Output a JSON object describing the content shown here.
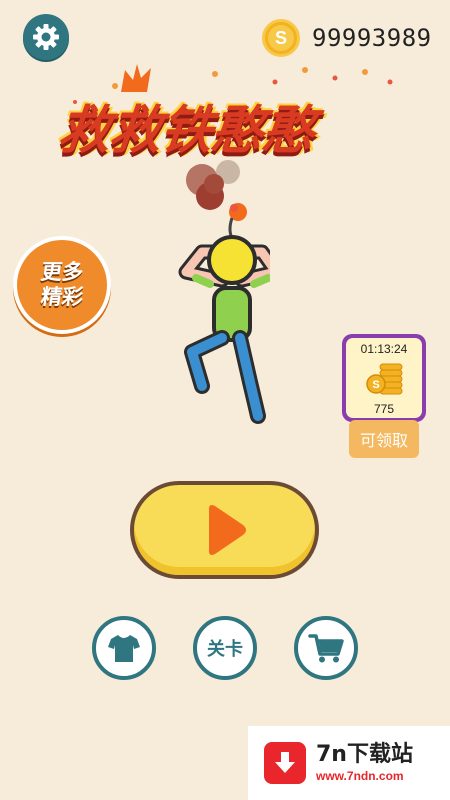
{
  "top_bar": {
    "settings_icon": "gear-icon",
    "coin_icon": "coin-icon",
    "coin_symbol": "S",
    "coin_count": "99993989"
  },
  "title": {
    "text": "救救铁憨憨"
  },
  "side": {
    "more_games_line1": "更多",
    "more_games_line2": "精彩"
  },
  "reward": {
    "timer": "01:13:24",
    "amount": "775",
    "claim_label": "可领取"
  },
  "bottom": {
    "play_icon": "play-icon",
    "skin_icon": "shirt-icon",
    "level_label": "关卡",
    "shop_icon": "cart-icon"
  },
  "watermark": {
    "name": "7n下载站",
    "url": "www.7ndn.com"
  },
  "colors": {
    "background": "#f6ecd9",
    "teal": "#2f7680",
    "title_red": "#d93a22",
    "play_yellow": "#f8db57",
    "play_orange": "#f26b1d",
    "badge_orange": "#f08b2b",
    "reward_purple": "#8a3dad"
  }
}
